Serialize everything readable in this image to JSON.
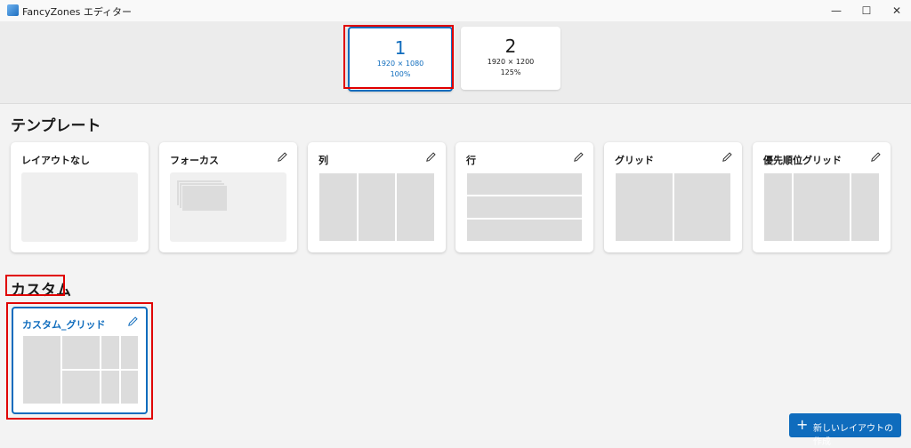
{
  "window": {
    "title": "FancyZones エディター",
    "min_glyph": "—",
    "max_glyph": "☐",
    "close_glyph": "✕"
  },
  "monitors": [
    {
      "number": "1",
      "resolution": "1920 × 1080",
      "scale": "100%",
      "selected": true
    },
    {
      "number": "2",
      "resolution": "1920 × 1200",
      "scale": "125%",
      "selected": false
    }
  ],
  "templates_heading": "テンプレート",
  "templates": [
    {
      "name": "レイアウトなし",
      "editable": false
    },
    {
      "name": "フォーカス",
      "editable": true
    },
    {
      "name": "列",
      "editable": true
    },
    {
      "name": "行",
      "editable": true
    },
    {
      "name": "グリッド",
      "editable": true
    },
    {
      "name": "優先順位グリッド",
      "editable": true
    }
  ],
  "custom_heading": "カスタム",
  "custom_layouts": [
    {
      "name": "カスタム_グリッド",
      "editable": true,
      "selected": true
    }
  ],
  "create_button": {
    "plus": "+",
    "label": "新しいレイアウトの作成"
  },
  "colors": {
    "accent": "#0f6cbd",
    "highlight": "#e00000",
    "zone": "#dcdcdc"
  }
}
